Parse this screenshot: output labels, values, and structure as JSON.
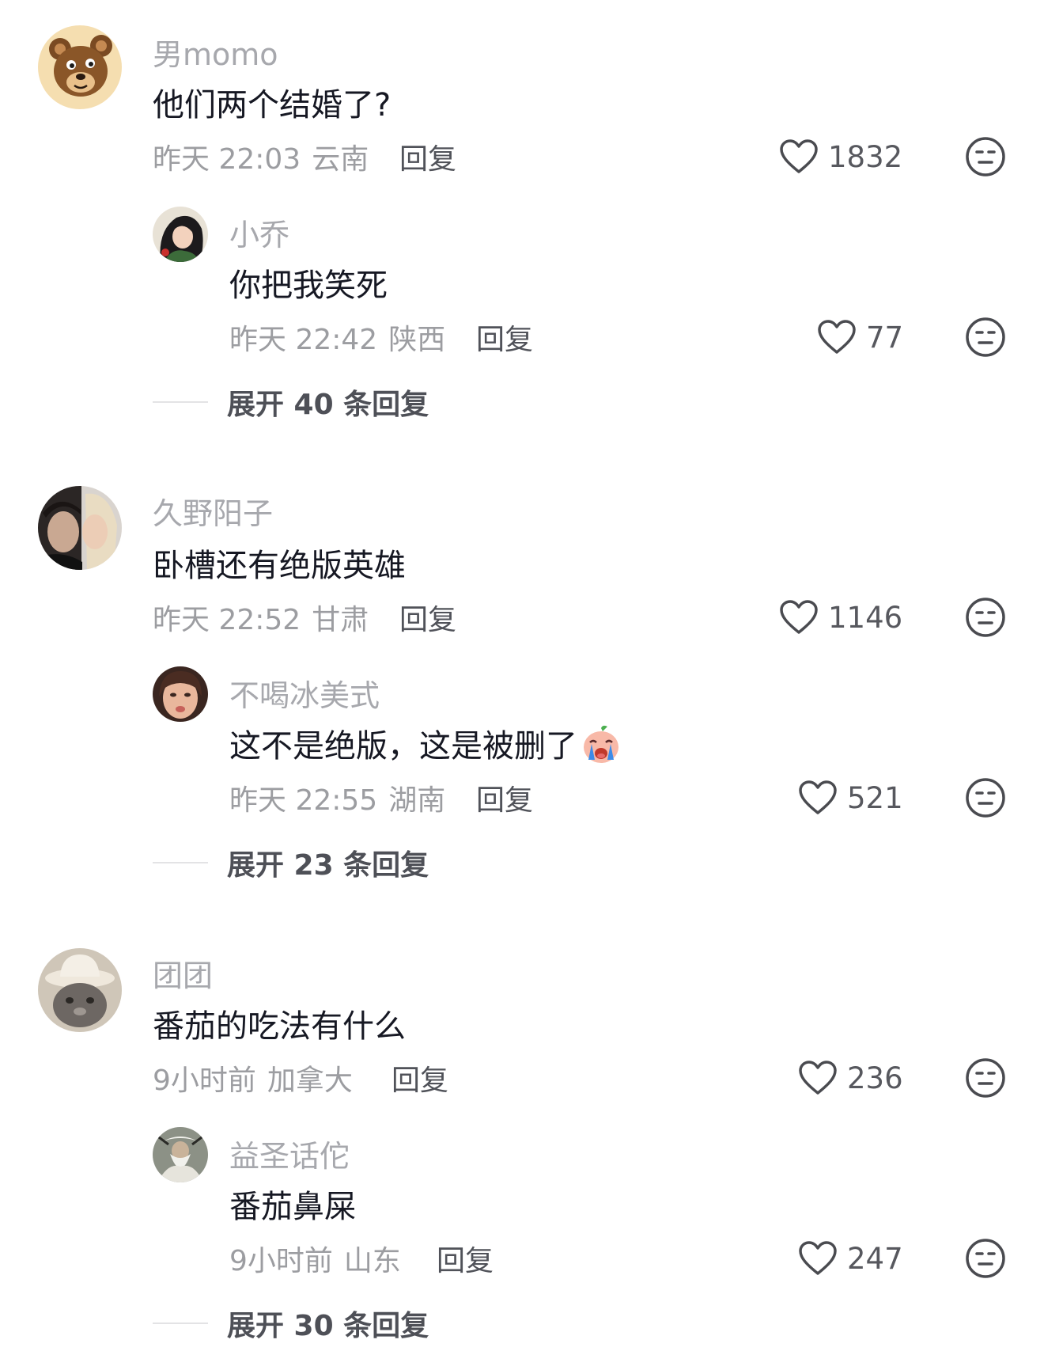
{
  "threads": [
    {
      "comment": {
        "username": "男momo",
        "text": "他们两个结婚了?",
        "time": "昨天 22:03",
        "location": "云南",
        "reply": "回复",
        "likes": "1832"
      },
      "reply": {
        "username": "小乔",
        "text": "你把我笑死",
        "time": "昨天 22:42",
        "location": "陕西",
        "reply": "回复",
        "likes": "77"
      },
      "expand": "展开 40 条回复"
    },
    {
      "comment": {
        "username": "久野阳子",
        "text": "卧槽还有绝版英雄",
        "time": "昨天 22:52",
        "location": "甘肃",
        "reply": "回复",
        "likes": "1146"
      },
      "reply": {
        "username": "不喝冰美式",
        "text": "这不是绝版，这是被删了",
        "emoji": "crying-face-emoji",
        "time": "昨天 22:55",
        "location": "湖南",
        "reply": "回复",
        "likes": "521"
      },
      "expand": "展开 23 条回复"
    },
    {
      "comment": {
        "username": "团团",
        "text": "番茄的吃法有什么",
        "time": "9小时前",
        "location": "加拿大",
        "reply": "回复",
        "likes": "236"
      },
      "reply": {
        "username": "益圣话佗",
        "text": "番茄鼻屎",
        "time": "9小时前",
        "location": "山东",
        "reply": "回复",
        "likes": "247"
      },
      "expand": "展开 30 条回复"
    }
  ],
  "icons": {
    "like": "heart-outline-icon",
    "dislike": "neutral-face-icon"
  }
}
